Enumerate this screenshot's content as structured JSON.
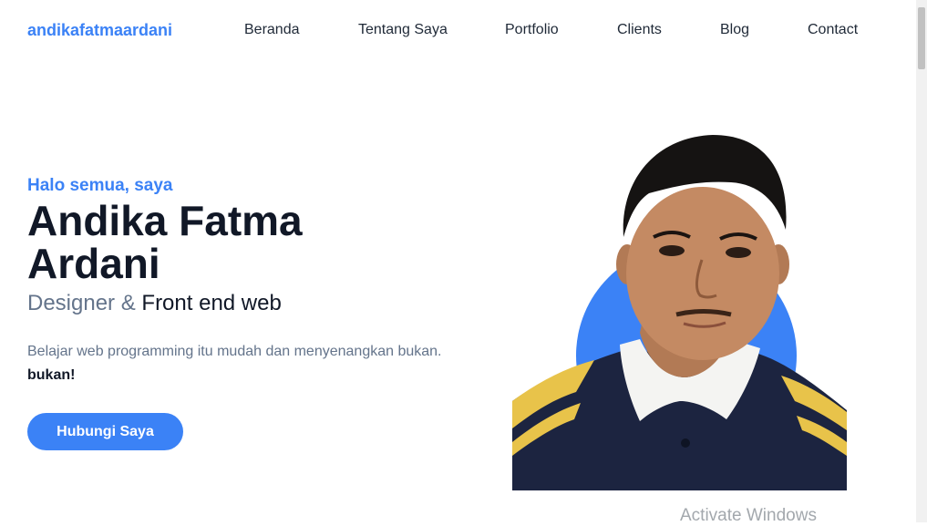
{
  "navbar": {
    "brand": "andikafatmaardani",
    "links": [
      "Beranda",
      "Tentang Saya",
      "Portfolio",
      "Clients",
      "Blog",
      "Contact"
    ]
  },
  "hero": {
    "greeting": "Halo semua, saya",
    "name": "Andika Fatma Ardani",
    "role_prefix": "Designer &",
    "role_main": "Front end web",
    "description": "Belajar web programming itu mudah dan menyenangkan bukan.",
    "description_bold": "bukan!",
    "cta_label": "Hubungi Saya"
  },
  "watermark": "Activate Windows",
  "colors": {
    "accent": "#3b82f6",
    "heading": "#111827",
    "muted": "#64748b"
  }
}
